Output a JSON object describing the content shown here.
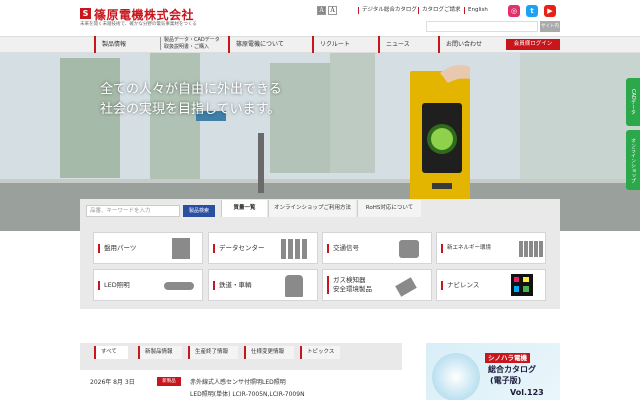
{
  "header": {
    "logo_mark": "S",
    "company_name": "篠原電機株式会社",
    "tagline": "未来を開く未踏技術で、確かな分野の電気事業材をつくる",
    "font_small": "A",
    "font_large": "A",
    "links": [
      "デジタル総合カタログ",
      "カタログご請求",
      "English"
    ],
    "sns": [
      {
        "name": "instagram-icon",
        "color": "#e1306c",
        "glyph": "◎"
      },
      {
        "name": "twitter-icon",
        "color": "#1da1f2",
        "glyph": "t"
      },
      {
        "name": "youtube-icon",
        "color": "#e62117",
        "glyph": "▶"
      }
    ],
    "search_button": "サイト内検索"
  },
  "nav": {
    "items": [
      "製品情報",
      "製品データ・CADデータ",
      "取扱説明書・ご購入",
      "篠原電機について",
      "リクルート",
      "ニュース",
      "お問い合わせ"
    ],
    "member_login": "会員様ログイン"
  },
  "hero": {
    "copy_line1": "全ての人々が自由に外出できる",
    "copy_line2": "社会の実現を目指しています。"
  },
  "side_tabs": [
    "CADデータ",
    "オンラインショップ"
  ],
  "product_search": {
    "placeholder": "品番、キーワードを入力",
    "button": "製品検索",
    "tabs": [
      "質量一覧",
      "オンラインショップご利用方法",
      "RoHS対応について"
    ]
  },
  "categories": [
    {
      "label": "盤用パーツ"
    },
    {
      "label": "データセンター"
    },
    {
      "label": "交通信号"
    },
    {
      "label": "新エネルギー環境"
    },
    {
      "label": "LED照明"
    },
    {
      "label": "鉄道・車輌"
    },
    {
      "label": "ガス検知器",
      "label2": "安全環境製品"
    },
    {
      "label": "ナビレンス"
    }
  ],
  "news": {
    "tabs": [
      "すべて",
      "新製品情報",
      "生産終了情報",
      "仕様変更情報",
      "トピックス"
    ],
    "date": "2026年 8月 3日",
    "badge": "新製品",
    "title_line1": "赤外線式人感センサ付照明LED照明",
    "title_line2": "LED照明(単体) LCIR-7005N,LCIR-7009N"
  },
  "catalog": {
    "brand": "シノハラ電機",
    "line1": "総合カタログ",
    "line2": "(電子版)",
    "line3": "Vol.123"
  },
  "colors": {
    "brand_red": "#c8161d",
    "accent_green": "#2aa84a",
    "search_blue": "#2a4fa0"
  }
}
